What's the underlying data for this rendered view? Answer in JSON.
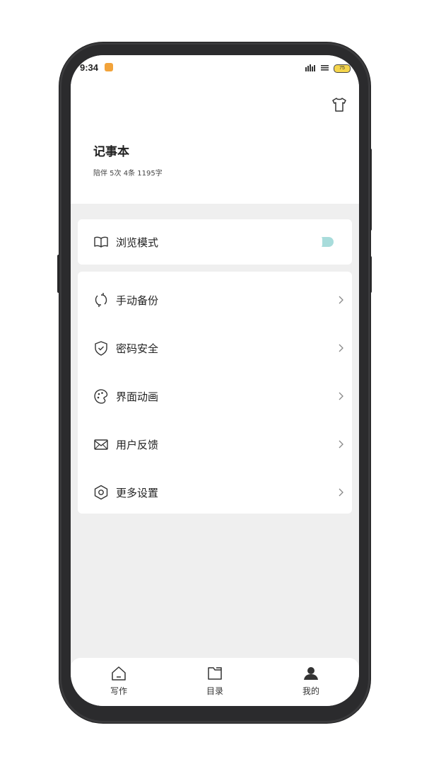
{
  "status_bar": {
    "time": "9:34",
    "battery": "75",
    "app_icon": "app-notification-icon"
  },
  "header": {
    "title": "记事本",
    "stats": "陪伴 5次 4条 1195字",
    "theme_icon": "shirt-icon"
  },
  "browse_mode": {
    "label": "浏览模式",
    "icon": "book-icon",
    "enabled": true,
    "accent_color": "#a8dcdb"
  },
  "menu": [
    {
      "label": "手动备份",
      "icon": "sync-icon"
    },
    {
      "label": "密码安全",
      "icon": "shield-check-icon"
    },
    {
      "label": "界面动画",
      "icon": "palette-icon"
    },
    {
      "label": "用户反馈",
      "icon": "mail-icon"
    },
    {
      "label": "更多设置",
      "icon": "hexagon-settings-icon"
    }
  ],
  "bottom_nav": [
    {
      "label": "写作",
      "icon": "home-icon"
    },
    {
      "label": "目录",
      "icon": "folder-icon"
    },
    {
      "label": "我的",
      "icon": "user-icon",
      "active": true
    }
  ]
}
